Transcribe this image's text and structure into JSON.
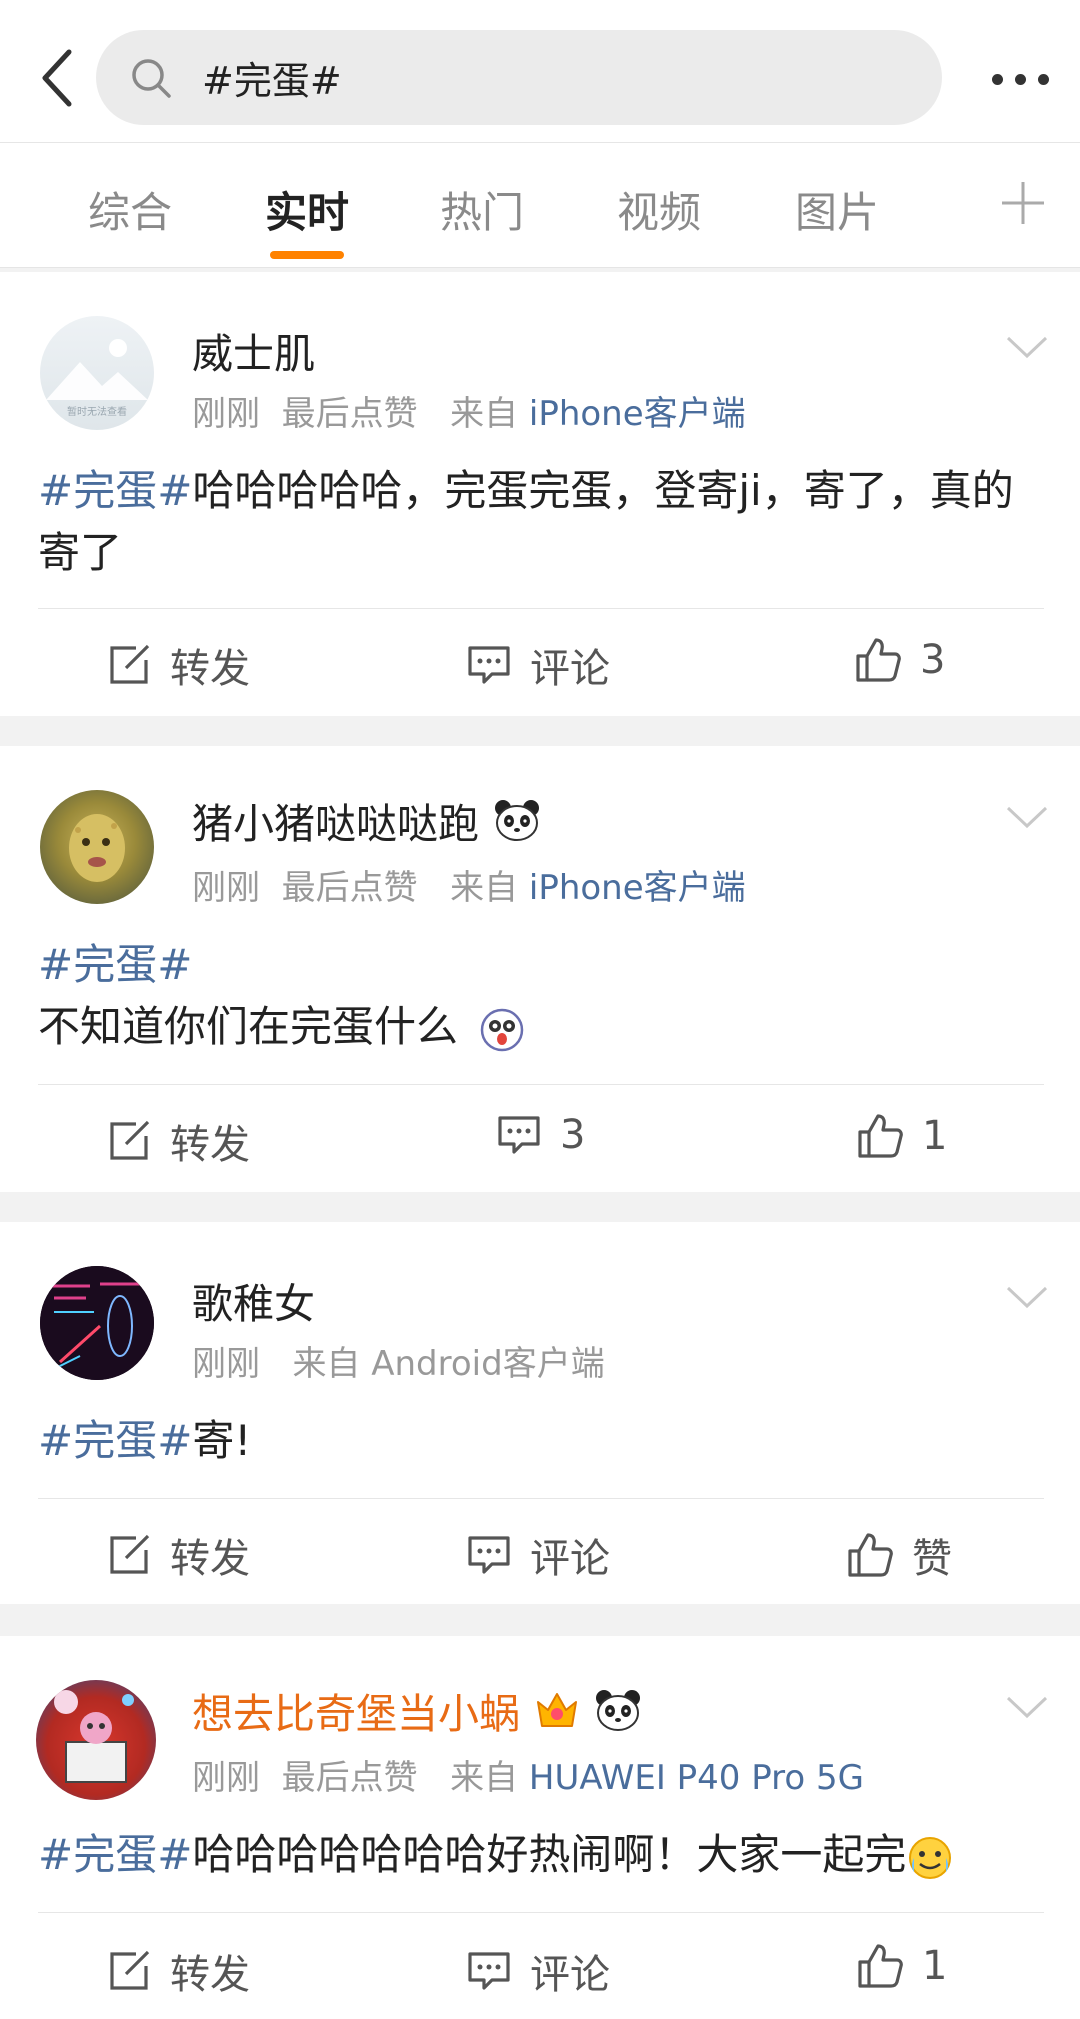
{
  "header": {
    "search_query": "#完蛋#"
  },
  "tabs": [
    {
      "label": "综合"
    },
    {
      "label": "实时"
    },
    {
      "label": "热门"
    },
    {
      "label": "视频"
    },
    {
      "label": "图片"
    }
  ],
  "avatar_placeholder_text": "暂时无法查看",
  "posts": [
    {
      "user": "威士肌",
      "time": "刚刚",
      "extra": "最后点赞",
      "from_label": "来自",
      "source": "iPhone客户端",
      "tag": "#完蛋#",
      "text": "哈哈哈哈哈，完蛋完蛋，登寄ji，寄了，真的寄了",
      "repost_label": "转发",
      "comment_label": "评论",
      "like_label": "3"
    },
    {
      "user": "猪小猪哒哒哒跑",
      "time": "刚刚",
      "extra": "最后点赞",
      "from_label": "来自",
      "source": "iPhone客户端",
      "tag": "#完蛋#",
      "text": "不知道你们在完蛋什么",
      "repost_label": "转发",
      "comment_label": "3",
      "like_label": "1"
    },
    {
      "user": "歌稚女",
      "time": "刚刚",
      "extra": "",
      "from_label": "来自",
      "source": "Android客户端",
      "tag": "#完蛋#",
      "text": "寄!",
      "repost_label": "转发",
      "comment_label": "评论",
      "like_label": "赞"
    },
    {
      "user": "想去比奇堡当小蜗",
      "time": "刚刚",
      "extra": "最后点赞",
      "from_label": "来自",
      "source": "HUAWEI P40 Pro 5G",
      "tag": "#完蛋#",
      "text": "哈哈哈哈哈哈哈好热闹啊！大家一起完",
      "repost_label": "转发",
      "comment_label": "评论",
      "like_label": "1"
    }
  ],
  "colors": {
    "accent": "#ff8200",
    "link": "#4a6d9c",
    "vip_name": "#e86b15"
  }
}
